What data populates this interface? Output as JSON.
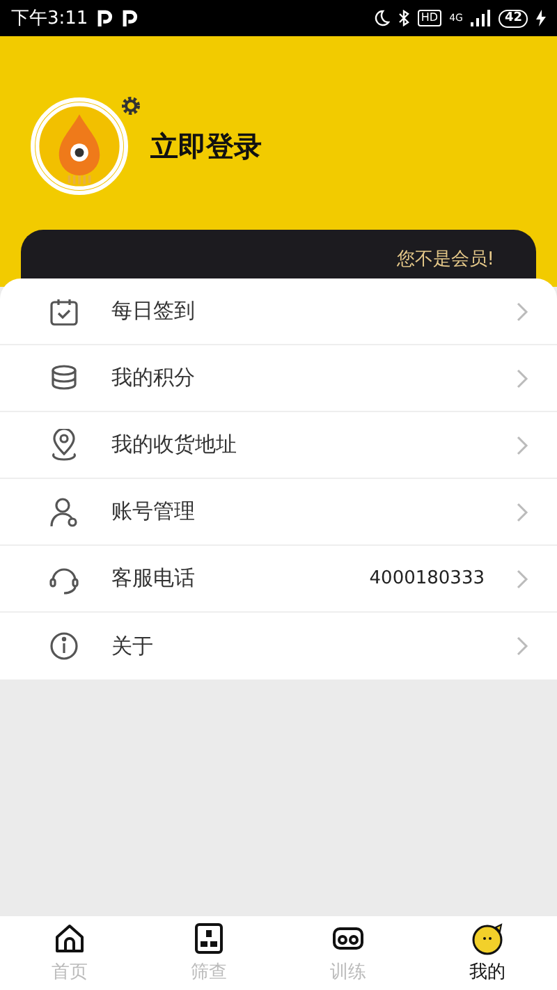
{
  "status_bar": {
    "time": "下午3:11",
    "network": "4G",
    "hd": "HD",
    "battery": "42"
  },
  "profile": {
    "login": "立即登录",
    "membership": "您不是会员!"
  },
  "menu": [
    {
      "label": "每日签到"
    },
    {
      "label": "我的积分"
    },
    {
      "label": "我的收货地址"
    },
    {
      "label": "账号管理"
    },
    {
      "label": "客服电话",
      "value": "4000180333"
    },
    {
      "label": "关于"
    }
  ],
  "tabs": [
    {
      "label": "首页",
      "selected": false
    },
    {
      "label": "筛查",
      "selected": false
    },
    {
      "label": "训练",
      "selected": false
    },
    {
      "label": "我的",
      "selected": true
    }
  ]
}
